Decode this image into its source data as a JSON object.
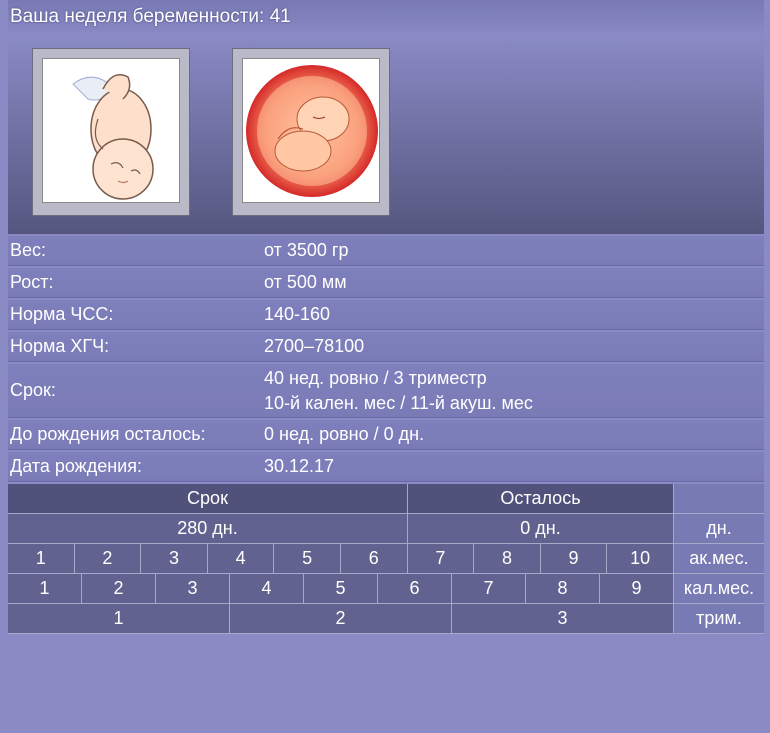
{
  "header": {
    "label": "Ваша неделя беременности:",
    "week": "41"
  },
  "images": {
    "left_icon": "fetus-illustration-icon",
    "right_icon": "fetus-in-womb-icon"
  },
  "info": [
    {
      "label": "Вес:",
      "value": "от 3500 гр"
    },
    {
      "label": "Рост:",
      "value": "от 500 мм"
    },
    {
      "label": "Норма ЧСС:",
      "value": "140-160"
    },
    {
      "label": "Норма ХГЧ:",
      "value": "2700–78100"
    },
    {
      "label": "Срок:",
      "value": "40 нед. ровно / 3 триместр",
      "value2": "10-й кален. мес / 11-й акуш. мес"
    },
    {
      "label": "До рождения осталось:",
      "value": "0 нед. ровно / 0 дн."
    },
    {
      "label": "Дата рождения:",
      "value": "30.12.17"
    }
  ],
  "table": {
    "head_term": "Срок",
    "head_left": "Осталось",
    "term_days": "280 дн.",
    "left_days": "0 дн.",
    "unit_days": "дн.",
    "obstetric_months": [
      "1",
      "2",
      "3",
      "4",
      "5",
      "6",
      "7",
      "8",
      "9",
      "10"
    ],
    "unit_obstetric": "ак.мес.",
    "calendar_months": [
      "1",
      "2",
      "3",
      "4",
      "5",
      "6",
      "7",
      "8",
      "9"
    ],
    "unit_calendar": "кал.мес.",
    "trimesters": [
      "1",
      "2",
      "3"
    ],
    "unit_trimester": "трим."
  }
}
